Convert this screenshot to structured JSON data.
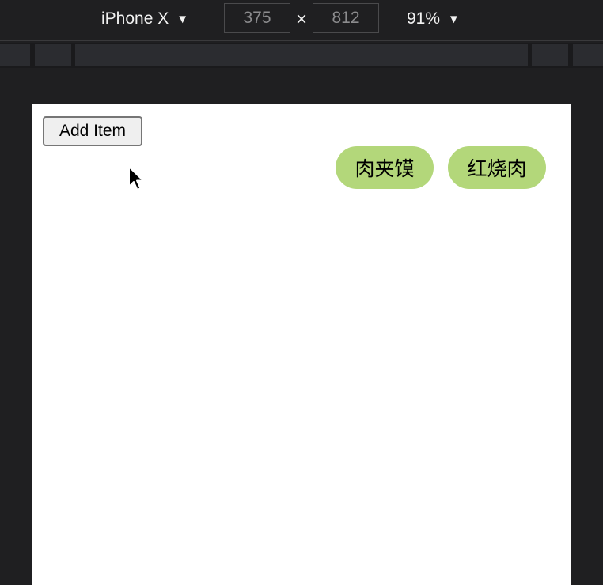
{
  "device_toolbar": {
    "device_name": "iPhone X",
    "width_value": "375",
    "height_value": "812",
    "times_symbol": "×",
    "zoom_value": "91%",
    "caret": "▼"
  },
  "viewport": {
    "add_button_label": "Add Item",
    "items": [
      "肉夹馍",
      "红烧肉"
    ]
  },
  "colors": {
    "devtools_bg": "#1f1f21",
    "chip_bg": "#b3d77a",
    "viewport_bg": "#ffffff"
  },
  "icons": {
    "cursor": "mouse-pointer-icon",
    "dropdown": "chevron-down-icon"
  }
}
